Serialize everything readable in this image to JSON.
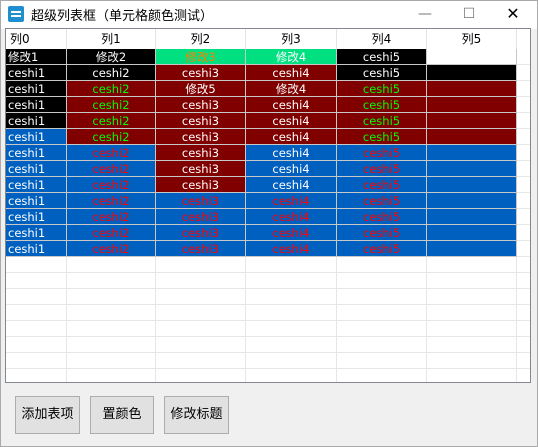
{
  "window": {
    "title": "超级列表框（单元格颜色测试）",
    "controls": {
      "minimize": "—",
      "maximize": "☐",
      "close": "✕"
    }
  },
  "listview": {
    "columns": [
      "列0",
      "列1",
      "列2",
      "列3",
      "列4",
      "列5"
    ],
    "colors": {
      "black": "#000000",
      "maroon": "#800000",
      "blue": "#0060c0",
      "green_bg": "#00ff80",
      "white": "#ffffff",
      "lime": "#00ff00",
      "red": "#ff0000",
      "orange": "#ff8000"
    },
    "rows": [
      {
        "cells": [
          {
            "text": "修改1",
            "bg": "#000000",
            "fg": "#ffffff"
          },
          {
            "text": "修改2",
            "bg": "#000000",
            "fg": "#ffffff"
          },
          {
            "text": "修改3",
            "bg": "#00e080",
            "fg": "#ff8000"
          },
          {
            "text": "修改4",
            "bg": "#00e080",
            "fg": "#ffffff"
          },
          {
            "text": "ceshi5",
            "bg": "#000000",
            "fg": "#ffffff"
          },
          {
            "text": "",
            "bg": "#ffffff",
            "fg": "#000000"
          }
        ]
      },
      {
        "cells": [
          {
            "text": "ceshi1",
            "bg": "#000000",
            "fg": "#ffffff"
          },
          {
            "text": "ceshi2",
            "bg": "#000000",
            "fg": "#ffffff"
          },
          {
            "text": "ceshi3",
            "bg": "#800000",
            "fg": "#ffffff"
          },
          {
            "text": "ceshi4",
            "bg": "#800000",
            "fg": "#ffffff"
          },
          {
            "text": "ceshi5",
            "bg": "#000000",
            "fg": "#ffffff"
          },
          {
            "text": "",
            "bg": "#000000",
            "fg": "#ffffff"
          }
        ]
      },
      {
        "cells": [
          {
            "text": "ceshi1",
            "bg": "#000000",
            "fg": "#ffffff"
          },
          {
            "text": "ceshi2",
            "bg": "#800000",
            "fg": "#00ff00"
          },
          {
            "text": "修改5",
            "bg": "#800000",
            "fg": "#ffffff"
          },
          {
            "text": "修改4",
            "bg": "#800000",
            "fg": "#ffffff"
          },
          {
            "text": "ceshi5",
            "bg": "#800000",
            "fg": "#00ff00"
          },
          {
            "text": "",
            "bg": "#800000",
            "fg": "#ffffff"
          }
        ]
      },
      {
        "cells": [
          {
            "text": "ceshi1",
            "bg": "#000000",
            "fg": "#ffffff"
          },
          {
            "text": "ceshi2",
            "bg": "#800000",
            "fg": "#00ff00"
          },
          {
            "text": "ceshi3",
            "bg": "#800000",
            "fg": "#ffffff"
          },
          {
            "text": "ceshi4",
            "bg": "#800000",
            "fg": "#ffffff"
          },
          {
            "text": "ceshi5",
            "bg": "#800000",
            "fg": "#00ff00"
          },
          {
            "text": "",
            "bg": "#800000",
            "fg": "#ffffff"
          }
        ]
      },
      {
        "cells": [
          {
            "text": "ceshi1",
            "bg": "#000000",
            "fg": "#ffffff"
          },
          {
            "text": "ceshi2",
            "bg": "#800000",
            "fg": "#00ff00"
          },
          {
            "text": "ceshi3",
            "bg": "#800000",
            "fg": "#ffffff"
          },
          {
            "text": "ceshi4",
            "bg": "#800000",
            "fg": "#ffffff"
          },
          {
            "text": "ceshi5",
            "bg": "#800000",
            "fg": "#00ff00"
          },
          {
            "text": "",
            "bg": "#800000",
            "fg": "#ffffff"
          }
        ]
      },
      {
        "cells": [
          {
            "text": "ceshi1",
            "bg": "#0060c0",
            "fg": "#ffffff"
          },
          {
            "text": "ceshi2",
            "bg": "#800000",
            "fg": "#00ff00"
          },
          {
            "text": "ceshi3",
            "bg": "#800000",
            "fg": "#ffffff"
          },
          {
            "text": "ceshi4",
            "bg": "#800000",
            "fg": "#ffffff"
          },
          {
            "text": "ceshi5",
            "bg": "#800000",
            "fg": "#00ff00"
          },
          {
            "text": "",
            "bg": "#800000",
            "fg": "#ffffff"
          }
        ]
      },
      {
        "cells": [
          {
            "text": "ceshi1",
            "bg": "#0060c0",
            "fg": "#ffffff"
          },
          {
            "text": "ceshi2",
            "bg": "#0060c0",
            "fg": "#ff0000"
          },
          {
            "text": "ceshi3",
            "bg": "#800000",
            "fg": "#ffffff"
          },
          {
            "text": "ceshi4",
            "bg": "#0060c0",
            "fg": "#ffffff"
          },
          {
            "text": "ceshi5",
            "bg": "#0060c0",
            "fg": "#ff0000"
          },
          {
            "text": "",
            "bg": "#0060c0",
            "fg": "#ffffff"
          }
        ]
      },
      {
        "cells": [
          {
            "text": "ceshi1",
            "bg": "#0060c0",
            "fg": "#ffffff"
          },
          {
            "text": "ceshi2",
            "bg": "#0060c0",
            "fg": "#ff0000"
          },
          {
            "text": "ceshi3",
            "bg": "#800000",
            "fg": "#ffffff"
          },
          {
            "text": "ceshi4",
            "bg": "#0060c0",
            "fg": "#ffffff"
          },
          {
            "text": "ceshi5",
            "bg": "#0060c0",
            "fg": "#ff0000"
          },
          {
            "text": "",
            "bg": "#0060c0",
            "fg": "#ffffff"
          }
        ]
      },
      {
        "cells": [
          {
            "text": "ceshi1",
            "bg": "#0060c0",
            "fg": "#ffffff"
          },
          {
            "text": "ceshi2",
            "bg": "#0060c0",
            "fg": "#ff0000"
          },
          {
            "text": "ceshi3",
            "bg": "#800000",
            "fg": "#ffffff"
          },
          {
            "text": "ceshi4",
            "bg": "#0060c0",
            "fg": "#ffffff"
          },
          {
            "text": "ceshi5",
            "bg": "#0060c0",
            "fg": "#ff0000"
          },
          {
            "text": "",
            "bg": "#0060c0",
            "fg": "#ffffff"
          }
        ]
      },
      {
        "cells": [
          {
            "text": "ceshi1",
            "bg": "#0060c0",
            "fg": "#ffffff"
          },
          {
            "text": "ceshi2",
            "bg": "#0060c0",
            "fg": "#ff0000"
          },
          {
            "text": "ceshi3",
            "bg": "#0060c0",
            "fg": "#ff0000"
          },
          {
            "text": "ceshi4",
            "bg": "#0060c0",
            "fg": "#ff0000"
          },
          {
            "text": "ceshi5",
            "bg": "#0060c0",
            "fg": "#ff0000"
          },
          {
            "text": "",
            "bg": "#0060c0",
            "fg": "#ffffff"
          }
        ]
      },
      {
        "cells": [
          {
            "text": "ceshi1",
            "bg": "#0060c0",
            "fg": "#ffffff"
          },
          {
            "text": "ceshi2",
            "bg": "#0060c0",
            "fg": "#ff0000"
          },
          {
            "text": "ceshi3",
            "bg": "#0060c0",
            "fg": "#ff0000"
          },
          {
            "text": "ceshi4",
            "bg": "#0060c0",
            "fg": "#ff0000"
          },
          {
            "text": "ceshi5",
            "bg": "#0060c0",
            "fg": "#ff0000"
          },
          {
            "text": "",
            "bg": "#0060c0",
            "fg": "#ffffff"
          }
        ]
      },
      {
        "cells": [
          {
            "text": "ceshi1",
            "bg": "#0060c0",
            "fg": "#ffffff"
          },
          {
            "text": "ceshi2",
            "bg": "#0060c0",
            "fg": "#ff0000"
          },
          {
            "text": "ceshi3",
            "bg": "#0060c0",
            "fg": "#ff0000"
          },
          {
            "text": "ceshi4",
            "bg": "#0060c0",
            "fg": "#ff0000"
          },
          {
            "text": "ceshi5",
            "bg": "#0060c0",
            "fg": "#ff0000"
          },
          {
            "text": "",
            "bg": "#0060c0",
            "fg": "#ffffff"
          }
        ]
      },
      {
        "cells": [
          {
            "text": "ceshi1",
            "bg": "#0060c0",
            "fg": "#ffffff"
          },
          {
            "text": "ceshi2",
            "bg": "#0060c0",
            "fg": "#ff0000"
          },
          {
            "text": "ceshi3",
            "bg": "#0060c0",
            "fg": "#ff0000"
          },
          {
            "text": "ceshi4",
            "bg": "#0060c0",
            "fg": "#ff0000"
          },
          {
            "text": "ceshi5",
            "bg": "#0060c0",
            "fg": "#ff0000"
          },
          {
            "text": "",
            "bg": "#0060c0",
            "fg": "#ffffff"
          }
        ]
      }
    ]
  },
  "buttons": {
    "add_item": "添加表项",
    "set_color": "置颜色",
    "edit_title": "修改标题"
  }
}
